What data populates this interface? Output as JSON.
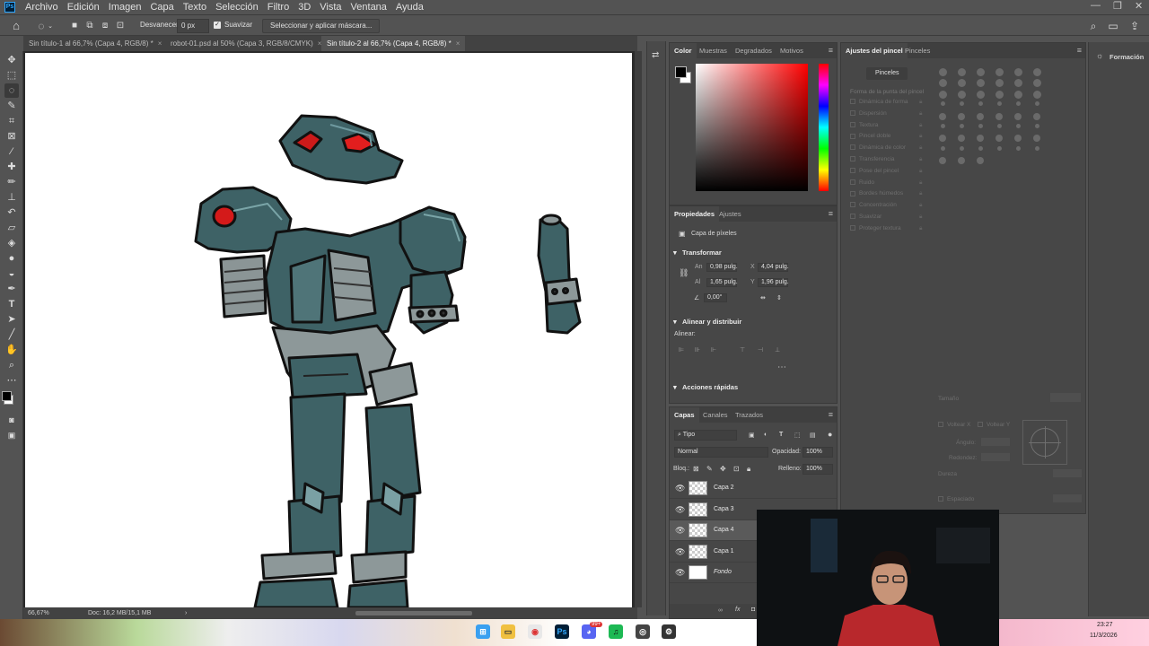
{
  "menu": {
    "items": [
      "Archivo",
      "Edición",
      "Imagen",
      "Capa",
      "Texto",
      "Selección",
      "Filtro",
      "3D",
      "Vista",
      "Ventana",
      "Ayuda"
    ]
  },
  "options": {
    "feather_label": "Desvanecer:",
    "feather_value": "0 px",
    "antialias_label": "Suavizar",
    "select_mask_button": "Seleccionar y aplicar máscara..."
  },
  "tabs": [
    {
      "label": "Sin título-1 al 66,7% (Capa 4, RGB/8) *",
      "active": false
    },
    {
      "label": "robot-01.psd al 50% (Capa 3, RGB/8/CMYK)",
      "active": false
    },
    {
      "label": "Sin título-2 al 66,7% (Capa 4, RGB/8) *",
      "active": true
    }
  ],
  "status": {
    "zoom": "66,67%",
    "doc": "Doc: 16,2 MB/15,1 MB"
  },
  "color_panel": {
    "tabs": [
      "Color",
      "Muestras",
      "Degradados",
      "Motivos"
    ],
    "foreground": "#000000",
    "background": "#ffffff",
    "hue_color": "#ff0000"
  },
  "properties_panel": {
    "tabs": [
      "Propiedades",
      "Ajustes"
    ],
    "layer_type": "Capa de píxeles",
    "transform_title": "Transformar",
    "w_label": "An",
    "w_value": "0,98 pulg.",
    "x_label": "X",
    "x_value": "4,04 pulg.",
    "h_label": "Al",
    "h_value": "1,65 pulg.",
    "y_label": "Y",
    "y_value": "1,96 pulg.",
    "angle_value": "0,00°",
    "align_title": "Alinear y distribuir",
    "align_label": "Alinear:",
    "quick_actions_title": "Acciones rápidas"
  },
  "layers_panel": {
    "tabs": [
      "Capas",
      "Canales",
      "Trazados"
    ],
    "filter_label": "Tipo",
    "blend_mode": "Normal",
    "opacity_label": "Opacidad:",
    "opacity_value": "100%",
    "lock_label": "Bloq.:",
    "fill_label": "Relleno:",
    "fill_value": "100%",
    "layers": [
      {
        "name": "Capa 2",
        "selected": false,
        "italic": false,
        "white": false
      },
      {
        "name": "Capa 3",
        "selected": false,
        "italic": false,
        "white": false
      },
      {
        "name": "Capa 4",
        "selected": true,
        "italic": false,
        "white": false
      },
      {
        "name": "Capa 1",
        "selected": false,
        "italic": false,
        "white": false
      },
      {
        "name": "Fondo",
        "selected": false,
        "italic": true,
        "white": true
      }
    ]
  },
  "brush_panel": {
    "tabs": [
      "Ajustes del pincel",
      "Pinceles"
    ],
    "brushes_button": "Pinceles",
    "tip_shape": "Forma de la punta del pincel",
    "options": [
      "Dinámica de forma",
      "Dispersión",
      "Textura",
      "Pincel doble",
      "Dinámica de color",
      "Transferencia",
      "Pose del pincel",
      "Ruido",
      "Bordes húmedos",
      "Concentración",
      "Suavizar",
      "Proteger textura"
    ],
    "size_label": "Tamaño",
    "flip_x": "Voltear X",
    "flip_y": "Voltear Y",
    "angle_label": "Ángulo:",
    "roundness_label": "Redondez:",
    "hardness_label": "Dureza",
    "spacing_label": "Espaciado"
  },
  "learn_panel": {
    "label": "Formación"
  },
  "taskbar": {
    "time": "23:27",
    "date": "11/3/2026",
    "badge": "99+"
  }
}
